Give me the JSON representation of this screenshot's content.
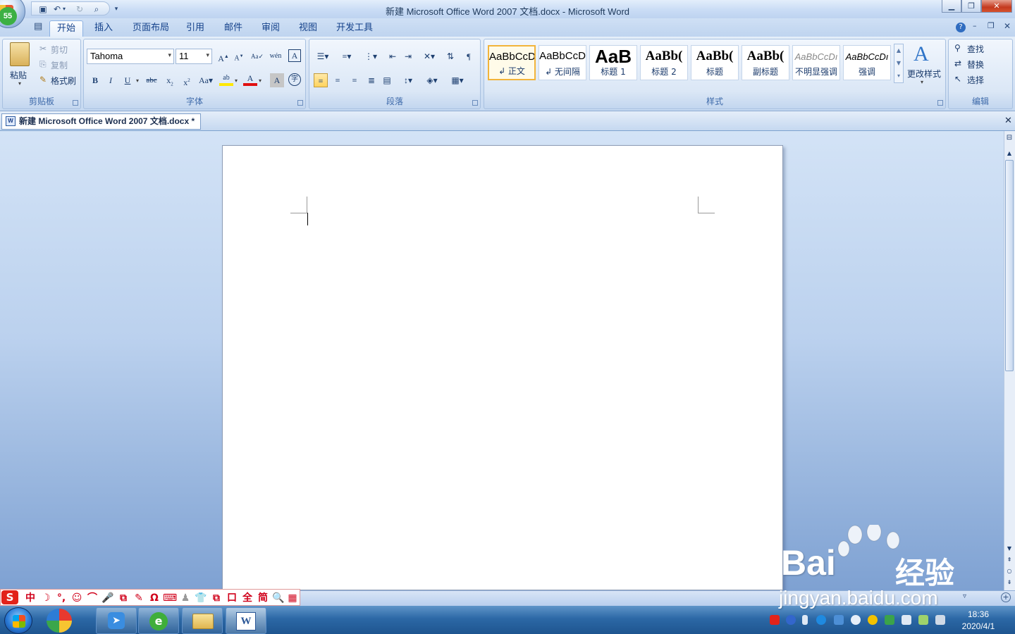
{
  "window": {
    "title": "新建 Microsoft Office Word 2007 文档.docx - Microsoft Word"
  },
  "badge": "55",
  "tabs": [
    "开始",
    "插入",
    "页面布局",
    "引用",
    "邮件",
    "审阅",
    "视图",
    "开发工具"
  ],
  "clipboard": {
    "paste": "粘贴",
    "cut": "剪切",
    "copy": "复制",
    "format_painter": "格式刷",
    "label": "剪贴板"
  },
  "font": {
    "name": "Tahoma",
    "size": "11",
    "label": "字体"
  },
  "paragraph": {
    "label": "段落"
  },
  "styles": {
    "label": "样式",
    "items": [
      {
        "preview": "AaBbCcD",
        "name": "↲ 正文"
      },
      {
        "preview": "AaBbCcD",
        "name": "↲ 无间隔"
      },
      {
        "preview": "AaB",
        "name": "标题 1"
      },
      {
        "preview": "AaBb(",
        "name": "标题 2"
      },
      {
        "preview": "AaBb(",
        "name": "标题"
      },
      {
        "preview": "AaBb(",
        "name": "副标题"
      },
      {
        "preview": "AaBbCcDı",
        "name": "不明显强调"
      },
      {
        "preview": "AaBbCcDı",
        "name": "强调"
      }
    ],
    "change": "更改样式"
  },
  "editing": {
    "find": "查找",
    "replace": "替换",
    "select": "选择",
    "label": "编辑"
  },
  "document": {
    "tab_title": "新建 Microsoft Office Word 2007 文档.docx *"
  },
  "ime": {
    "items": [
      "中",
      "☽",
      "°,",
      "☺",
      "⌒",
      "🎤",
      "⧉",
      "✎",
      "Ω",
      "⌨",
      "♟",
      "👕",
      "⧉",
      "口",
      "全",
      "简",
      "🔍",
      "▦"
    ]
  },
  "taskbar": {
    "time": "18:36",
    "date": "2020/4/1"
  },
  "watermark": {
    "brand": "Bai",
    "cn": "经验",
    "url": "jingyan.baidu.com"
  },
  "colors": {
    "ribbon": "#d4e2f4",
    "accent": "#15428b",
    "taskbar": "#2c68a6",
    "ime_red": "#d0021b"
  }
}
